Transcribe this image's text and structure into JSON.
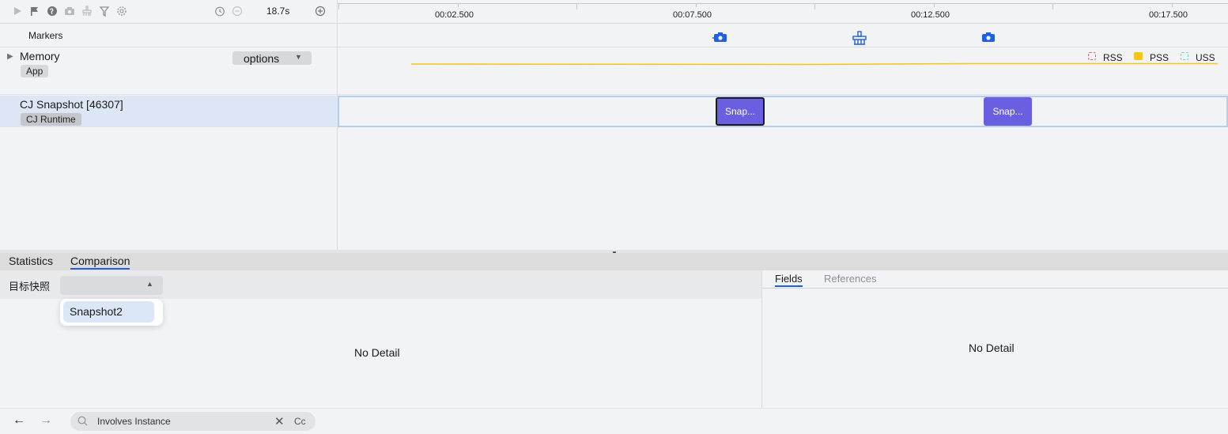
{
  "toolbar": {
    "duration": "18.7s",
    "icons": [
      "play-icon",
      "flag-icon",
      "globe-icon",
      "camera-icon",
      "broom-icon",
      "filter-icon",
      "gear-icon",
      "timer-icon",
      "minus-circle-icon",
      "plus-circle-icon"
    ]
  },
  "timeline": {
    "ticks": [
      "00:02.500",
      "00:07.500",
      "00:12.500",
      "00:17.500"
    ],
    "markers_label": "Markers"
  },
  "rows": {
    "memory": {
      "title": "Memory",
      "tag": "App",
      "options_label": "options",
      "legend": [
        {
          "name": "RSS",
          "color": "#e8647a",
          "style": "dashed"
        },
        {
          "name": "PSS",
          "color": "#f5c518",
          "style": "solid"
        },
        {
          "name": "USS",
          "color": "#6ed3c6",
          "style": "dashed"
        }
      ],
      "line_color": "#f5c518"
    },
    "snapshot": {
      "title": "CJ Snapshot [46307]",
      "tag": "CJ Runtime",
      "blocks": [
        {
          "label": "Snap...",
          "color": "#6a5fe0",
          "selected": true
        },
        {
          "label": "Snap...",
          "color": "#6a5fe0",
          "selected": false
        }
      ]
    }
  },
  "bottom": {
    "tabs": [
      "Statistics",
      "Comparison"
    ],
    "active_tab": "Comparison",
    "target_label": "目标快照",
    "dropdown_option": "Snapshot2",
    "left_empty": "No Detail",
    "right_tabs": [
      "Fields",
      "References"
    ],
    "right_active_tab": "Fields",
    "right_empty": "No Detail"
  },
  "footer": {
    "search_value": "Involves Instance",
    "case_label": "Cc"
  },
  "colors": {
    "accent": "#1f5ee6",
    "snapshot_block": "#6a5fe0",
    "selected_row": "#dde6f4"
  }
}
